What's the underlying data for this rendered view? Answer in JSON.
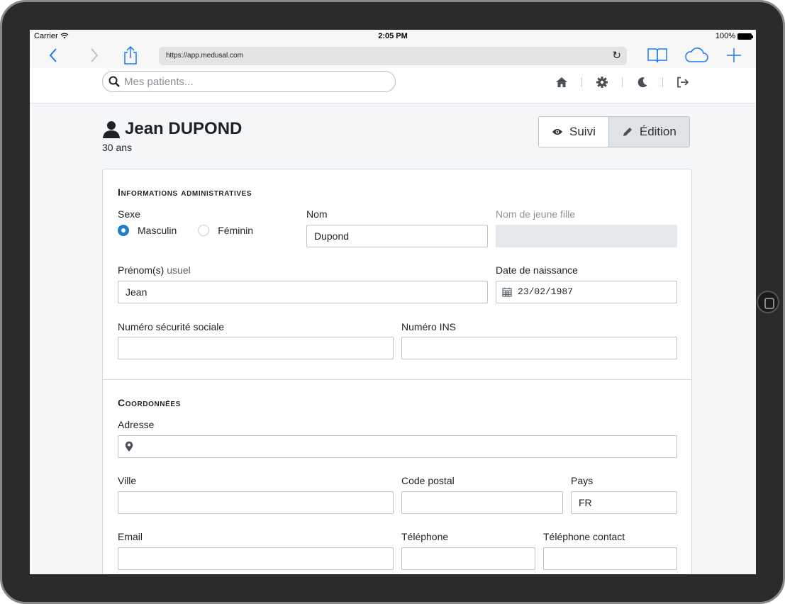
{
  "status_bar": {
    "carrier": "Carrier",
    "time": "2:05 PM",
    "battery": "100%"
  },
  "browser": {
    "url": "https://app.medusal.com"
  },
  "app_header": {
    "search_placeholder": "Mes patients...",
    "nav_icons": [
      "home-icon",
      "gear-icon",
      "moon-icon",
      "logout-icon"
    ]
  },
  "patient": {
    "name": "Jean DUPOND",
    "age": "30 ans"
  },
  "mode_buttons": {
    "suivi": "Suivi",
    "edition": "Édition"
  },
  "admin_section": {
    "title": "Informations administratives",
    "sexe_label": "Sexe",
    "sexe_options": [
      "Masculin",
      "Féminin"
    ],
    "sexe_selected": "Masculin",
    "nom_label": "Nom",
    "nom_value": "Dupond",
    "nom_jeune_fille_label": "Nom de jeune fille",
    "nom_jeune_fille_value": "",
    "prenom_label": "Prénom(s)",
    "prenom_label_sub": "usuel",
    "prenom_value": "Jean",
    "naissance_label": "Date de naissance",
    "naissance_value": "23/02/1987",
    "nss_label": "Numéro sécurité sociale",
    "nss_value": "",
    "ins_label": "Numéro INS",
    "ins_value": ""
  },
  "contact_section": {
    "title": "Coordonnées",
    "adresse_label": "Adresse",
    "adresse_value": "",
    "ville_label": "Ville",
    "ville_value": "",
    "code_postal_label": "Code postal",
    "code_postal_value": "",
    "pays_label": "Pays",
    "pays_value": "FR",
    "email_label": "Email",
    "email_value": "",
    "telephone_label": "Téléphone",
    "telephone_value": "",
    "telephone_contact_label": "Téléphone contact",
    "telephone_contact_value": ""
  },
  "colors": {
    "accent": "#1f7fc8",
    "safari_blue": "#1a7cf5",
    "disabled_field": "#e5e9ed"
  }
}
